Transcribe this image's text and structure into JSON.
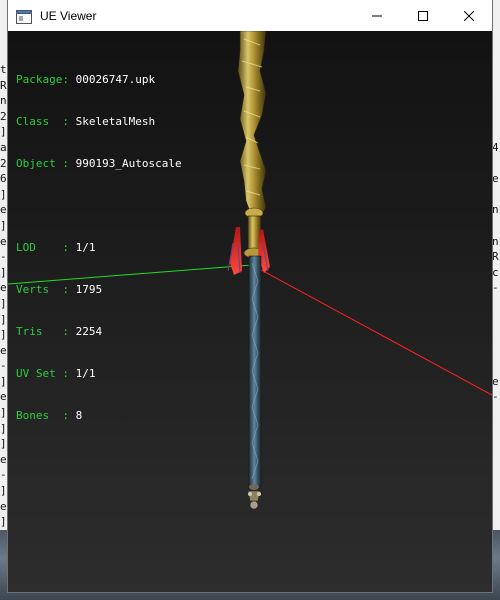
{
  "window": {
    "title": "UE Viewer",
    "controls": {
      "minimize": "minimize-icon",
      "maximize": "maximize-icon",
      "close": "close-icon"
    }
  },
  "info": {
    "package": {
      "label": "Package",
      "sep": ": ",
      "value": "00026747.upk"
    },
    "class": {
      "label": "Class  ",
      "sep": ": ",
      "value": "SkeletalMesh"
    },
    "object": {
      "label": "Object ",
      "sep": ": ",
      "value": "990193_Autoscale"
    },
    "lod": {
      "label": "LOD    ",
      "sep": ": ",
      "value": "1/1"
    },
    "verts": {
      "label": "Verts  ",
      "sep": ": ",
      "value": "1795"
    },
    "tris": {
      "label": "Tris   ",
      "sep": ": ",
      "value": "2254"
    },
    "uvset": {
      "label": "UV Set ",
      "sep": ": ",
      "value": "1/1"
    },
    "bones": {
      "label": "Bones  ",
      "sep": ": ",
      "value": "8"
    }
  },
  "background": {
    "left_chars": "t\nR\nn\n2\n]\na\n2\n6\n]\ne\n]\ne\n-\n]\ne\n]\n]\n]\ne\n-\n]\ne\n]\n]\n]\ne\n-\n]\ne\n]\n]",
    "right_chars": "\n\n\n\n\n4\n\ne\n\nn\n\nn\nR\nc\n-\n\n\n\n\n\ne\n-\n\n\n\n\n\n\n\n\n\ns\n-"
  },
  "colors": {
    "label_green": "#2ecc40",
    "value_white": "#ffffff",
    "axis_x_red": "#ff2020",
    "axis_y_green": "#22dd22"
  }
}
